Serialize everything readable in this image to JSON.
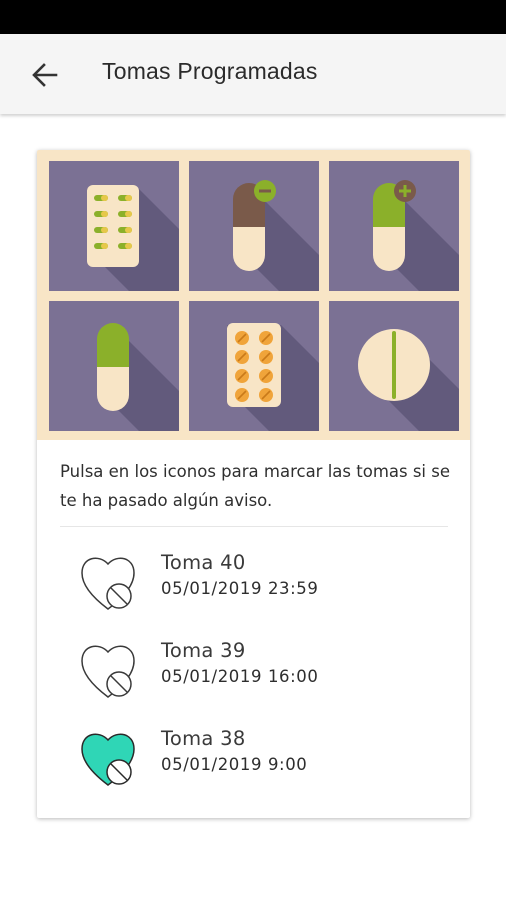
{
  "header": {
    "title": "Tomas Programadas",
    "back_icon": "arrow-left-icon"
  },
  "colors": {
    "tile_background": "#7b7194",
    "grid_background": "#f8e5c6",
    "pill_cream": "#f8e5c6",
    "pill_green": "#8bb02a",
    "pill_brown": "#7a5a4a",
    "tablet_orange": "#f0a43a",
    "taken_teal": "#2fd6b6"
  },
  "pill_tiles": [
    {
      "name": "blister-pack-green-icon"
    },
    {
      "name": "capsule-remove-icon"
    },
    {
      "name": "capsule-add-icon"
    },
    {
      "name": "capsule-green-icon"
    },
    {
      "name": "blister-pack-orange-icon"
    },
    {
      "name": "round-tablet-icon"
    }
  ],
  "instructions": "Pulsa en los iconos para marcar las tomas si se te ha pasado algún aviso.",
  "doses": [
    {
      "title": "Toma 40",
      "date": "05/01/2019 23:59",
      "taken": false
    },
    {
      "title": "Toma 39",
      "date": "05/01/2019 16:00",
      "taken": false
    },
    {
      "title": "Toma 38",
      "date": "05/01/2019 9:00",
      "taken": true
    }
  ]
}
